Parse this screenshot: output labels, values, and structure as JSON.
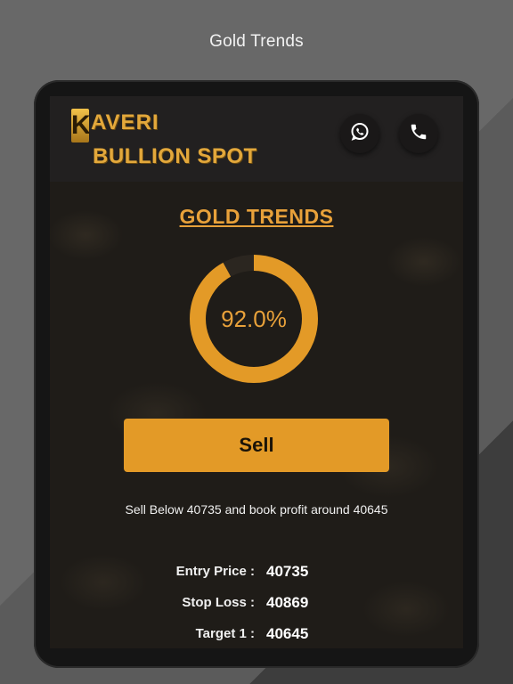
{
  "caption": "Gold Trends",
  "brand": {
    "logo_letter": "K",
    "logo_line1": "AVERI",
    "logo_line2": "BULLION SPOT"
  },
  "header_icons": [
    "whatsapp-icon",
    "phone-icon"
  ],
  "heading": "GOLD TRENDS",
  "progress": {
    "value_fraction": 0.92,
    "label": "92.0%"
  },
  "action_button": "Sell",
  "note": "Sell Below 40735 and book profit around 40645",
  "details": [
    {
      "label": "Entry Price :",
      "value": "40735"
    },
    {
      "label": "Stop Loss :",
      "value": "40869"
    },
    {
      "label": "Target 1 :",
      "value": "40645"
    }
  ],
  "colors": {
    "accent": "#e39a27",
    "gold_text": "#e8a13a",
    "background": "#1f1c18"
  }
}
